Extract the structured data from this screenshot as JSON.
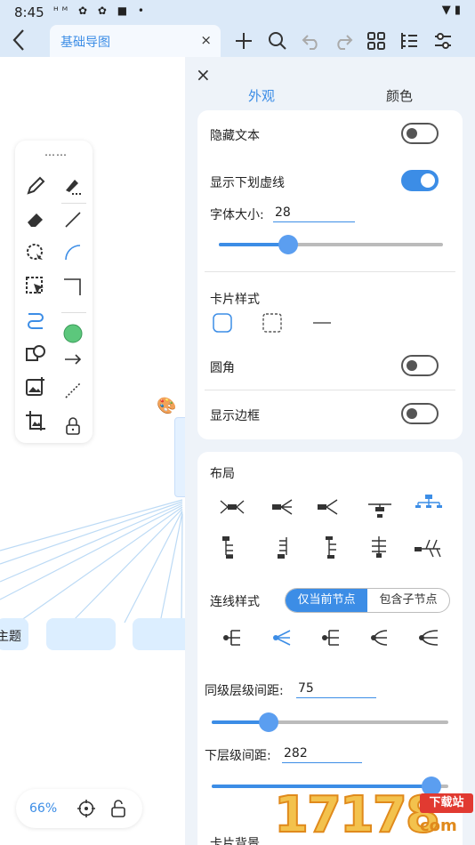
{
  "status_bar": {
    "time": "8:45",
    "left_icons": "ᴴᴹ ✿ ✿ ■ •",
    "right_icons": "▼ ▮"
  },
  "toolbar": {
    "tab_title": "基础导图",
    "tab_close": "×"
  },
  "canvas": {
    "node_label": "主题"
  },
  "palette": {
    "handle": "⋯⋯"
  },
  "zoom": {
    "label": "66%"
  },
  "panel": {
    "close": "×",
    "tabs": [
      {
        "label": "外观",
        "active": true
      },
      {
        "label": "颜色",
        "active": false
      }
    ],
    "hide_text_label": "隐藏文本",
    "hide_text_on": false,
    "underline_label": "显示下划虚线",
    "underline_on": true,
    "font_size_label": "字体大小:",
    "font_size_value": "28",
    "font_size_fraction": 0.31,
    "card_style_label": "卡片样式",
    "round_corner_label": "圆角",
    "round_corner_on": false,
    "show_border_label": "显示边框",
    "show_border_on": false,
    "layout_label": "布局",
    "line_style_label": "连线样式",
    "line_scope_options": [
      "仅当前节点",
      "包含子节点"
    ],
    "line_scope_selected": "仅当前节点",
    "sibling_spacing_label": "同级层级间距:",
    "sibling_spacing_value": "75",
    "sibling_spacing_fraction": 0.24,
    "lower_spacing_label": "下层级间距:",
    "lower_spacing_value": "282",
    "lower_spacing_fraction": 0.93,
    "card_bg_label": "卡片背景"
  },
  "colors": {
    "accent": "#3c8de6",
    "panel_bg": "#eef3f9",
    "canvas_line": "#bcdaf5"
  },
  "watermark": {
    "digits": "17178",
    "badge": "下载站",
    "sub": "com"
  }
}
